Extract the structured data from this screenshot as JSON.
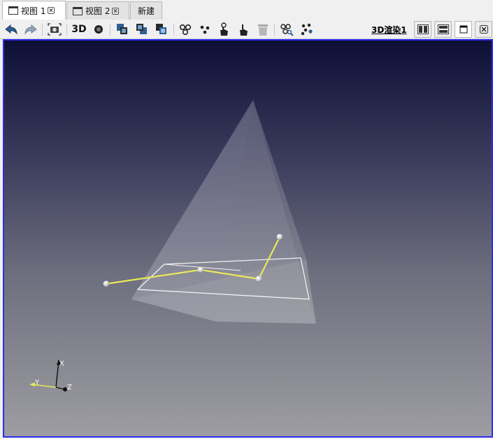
{
  "tabs": [
    {
      "label": "视图 1",
      "active": true,
      "closable": true
    },
    {
      "label": "视图 2",
      "active": false,
      "closable": true
    },
    {
      "label": "新建",
      "active": false,
      "closable": false
    }
  ],
  "toolbar": {
    "icons": [
      "undo-icon",
      "redo-icon",
      "screenshot-icon",
      "3d-icon",
      "sphere-icon",
      "layer-front-icon",
      "layer-back-icon",
      "layer-stack-icon",
      "connect-points-icon",
      "points-icon",
      "hand-pick-icon",
      "hand-pointer-icon",
      "trash-icon",
      "search-points-icon",
      "scatter-points-icon"
    ],
    "label_3d": "3D",
    "render_label": "3D渲染1",
    "layout_icons": [
      "split-vertical-icon",
      "split-horizontal-icon",
      "maximize-icon",
      "close-view-icon"
    ]
  },
  "viewport": {
    "background_top": "#0d0f36",
    "background_bottom": "#9d9da2",
    "border_color": "#2c2cf0",
    "polyline_color": "#e8e85a",
    "axes": {
      "x": "X",
      "y": "Y",
      "z": "Z"
    }
  }
}
